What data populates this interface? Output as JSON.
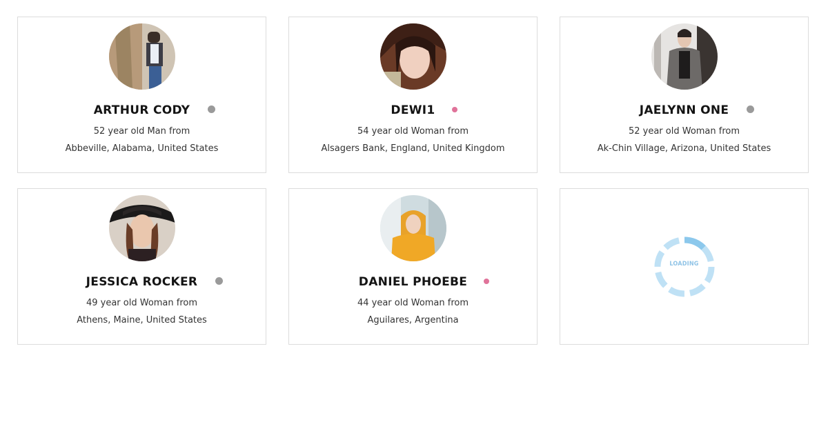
{
  "profiles": [
    {
      "name": "ARTHUR CODY",
      "age_line": "52 year old Man from",
      "location": "Abbeville, Alabama, United States",
      "status": "offline"
    },
    {
      "name": "DEWI1",
      "age_line": "54 year old Woman from",
      "location": "Alsagers Bank, England, United Kingdom",
      "status": "online"
    },
    {
      "name": "JAELYNN ONE",
      "age_line": "52 year old Woman from",
      "location": "Ak-Chin Village, Arizona, United States",
      "status": "offline"
    },
    {
      "name": "JESSICA ROCKER",
      "age_line": "49 year old Woman from",
      "location": "Athens, Maine, United States",
      "status": "offline"
    },
    {
      "name": "DANIEL PHOEBE",
      "age_line": "44 year old Woman from",
      "location": "Aguilares, Argentina",
      "status": "online"
    }
  ],
  "loading": {
    "label": "LOADING"
  },
  "colors": {
    "offline": "#9a9a9a",
    "online": "#e0739a",
    "loader": "#a9d6f2",
    "loader_active": "#7fbfe8"
  }
}
